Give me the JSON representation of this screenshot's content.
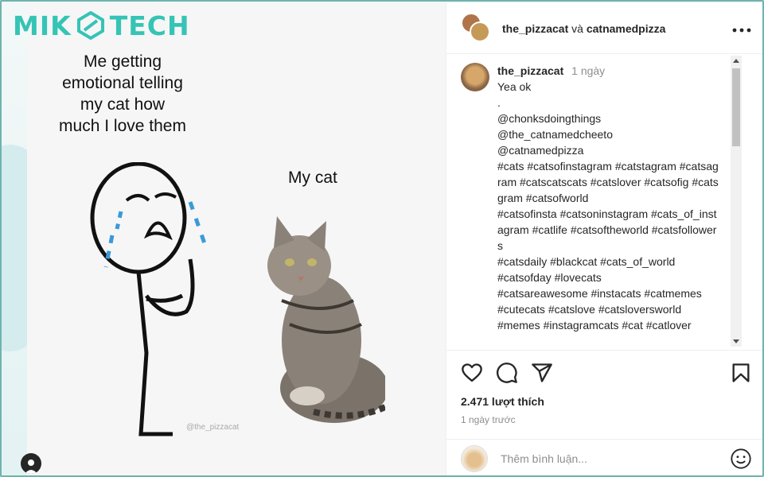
{
  "brand": {
    "logo_text_left": "MIK",
    "logo_text_right": "TECH",
    "accent": "#35c4b6"
  },
  "post": {
    "meme_left_text": "Me getting emotional telling my cat how much I love them",
    "meme_right_text": "My cat",
    "watermark": "@the_pizzacat"
  },
  "header": {
    "user1": "the_pizzacat",
    "conjunction": "và",
    "user2": "catnamedpizza",
    "more_icon": "more-horizontal-icon"
  },
  "caption": {
    "username": "the_pizzacat",
    "time": "1 ngày",
    "lines": [
      "Yea ok",
      ".",
      "@chonksdoingthings",
      "@the_catnamedcheeto",
      "@catnamedpizza",
      "#cats #catsofinstagram #catstagram #catsagram #catscatscats #catslover #catsofig #catsgram #catsofworld",
      "#catsofinsta #catsoninstagram #cats_of_instagram #catlife #catsoftheworld #catsfollowers",
      "#catsdaily #blackcat #cats_of_world",
      "#catsofday #lovecats",
      "#catsareawesome #instacats #catmemes",
      "#cutecats #catslove #catsloversworld",
      "#memes #instagramcats #cat #catlover"
    ]
  },
  "actions": {
    "icons": [
      "heart-icon",
      "comment-icon",
      "share-icon",
      "bookmark-icon"
    ],
    "likes": "2.471 lượt thích",
    "posted": "1 ngày trước"
  },
  "add_comment": {
    "placeholder": "Thêm bình luận...",
    "emoji_icon": "emoji-icon"
  }
}
